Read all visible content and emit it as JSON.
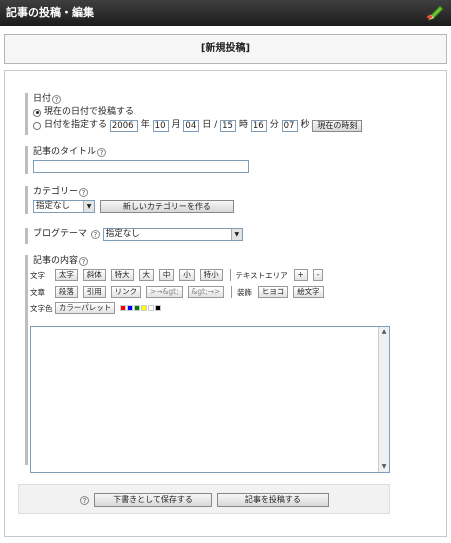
{
  "titlebar": {
    "title": "記事の投稿・編集"
  },
  "header": {
    "title": "[新規投稿]"
  },
  "date": {
    "label": "日付",
    "help": "?",
    "option_now": "現在の日付で投稿する",
    "option_specify": "日付を指定する",
    "year": "2006",
    "year_unit": "年",
    "month": "10",
    "month_unit": "月",
    "day": "04",
    "day_unit": "日",
    "slash": "/",
    "hour": "15",
    "hour_unit": "時",
    "minute": "16",
    "minute_unit": "分",
    "second": "07",
    "second_unit": "秒",
    "now_button": "現在の時刻"
  },
  "title_field": {
    "label": "記事のタイトル",
    "help": "?",
    "value": ""
  },
  "category": {
    "label": "カテゴリー",
    "help": "?",
    "selected": "指定なし",
    "new_button": "新しいカテゴリーを作る"
  },
  "blog_theme": {
    "label": "ブログテーマ",
    "help": "?",
    "selected": "指定なし"
  },
  "content": {
    "label": "記事の内容",
    "help": "?",
    "toolbar": {
      "row1_label": "文字",
      "row1_buttons": [
        "太字",
        "斜体",
        "特大",
        "大",
        "中",
        "小",
        "特小"
      ],
      "textarea_label": "テキストエリア",
      "plus": "+",
      "minus": "-",
      "row2_label": "文章",
      "row2_buttons": [
        "段落",
        "引用",
        "リンク",
        ">→&gt;",
        "&gt;→>"
      ],
      "decor_label": "装飾",
      "decor_buttons": [
        "ヒヨコ",
        "絵文字"
      ],
      "row3_label": "文字色",
      "palette_button": "カラーパレット",
      "swatches": [
        "#ff0000",
        "#0000ff",
        "#008000",
        "#ffff00",
        "#ffffff",
        "#000000"
      ]
    }
  },
  "footer": {
    "help": "?",
    "draft_button": "下書きとして保存する",
    "post_button": "記事を投稿する"
  }
}
